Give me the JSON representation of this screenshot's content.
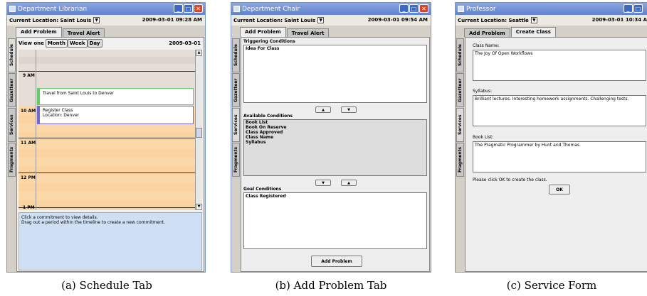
{
  "colors": {
    "title_start": "#8aa6e0",
    "title_end": "#5f83d0",
    "close": "#d8452a",
    "hour_bg": "#fcd8a8",
    "commit1_border": "#66cc66",
    "commit2_border": "#7766cc"
  },
  "win_a": {
    "title": "Department Librarian",
    "location": "Current Location: Saint Louis",
    "datetime": "2009-03-01 09:28 AM",
    "tabs": [
      "Add Problem",
      "Travel Alert"
    ],
    "vtabs": [
      "Schedule",
      "Gazetteer",
      "Services",
      "Fragments"
    ],
    "view_label": "View one",
    "view_buttons": [
      "Month",
      "Week",
      "Day"
    ],
    "date": "2009-03-01",
    "hours": [
      "9 AM",
      "10 AM",
      "11 AM",
      "12 PM",
      "1 PM"
    ],
    "commit1": "Travel from Saint Louis to Denver",
    "commit2_line1": "Register Class",
    "commit2_line2": "Location: Denver",
    "hint1": "Click a commitment to view details.",
    "hint2": "Drag out a period within the timeline to create a new commitment."
  },
  "win_b": {
    "title": "Department Chair",
    "location": "Current Location: Saint Louis",
    "datetime": "2009-03-01 09:54 AM",
    "tabs": [
      "Add Problem",
      "Travel Alert"
    ],
    "vtabs": [
      "Schedule",
      "Gazetteer",
      "Services",
      "Fragments"
    ],
    "triggering_label": "Triggering Conditions",
    "triggering_items": [
      "Idea For Class"
    ],
    "available_label": "Available Conditions",
    "available_items": [
      "Book List",
      "Book On Reserve",
      "Class Approved",
      "Class Name",
      "Syllabus"
    ],
    "goal_label": "Goal Conditions",
    "goal_items": [
      "Class Registered"
    ],
    "add_button": "Add Problem"
  },
  "win_c": {
    "title": "Professor",
    "location": "Current Location: Seattle",
    "datetime": "2009-03-01 10:34 A",
    "tabs": [
      "Add Problem",
      "Create Class"
    ],
    "vtabs": [
      "Schedule",
      "Gazetteer",
      "Services",
      "Fragments"
    ],
    "class_name_label": "Class Name:",
    "class_name_value": "The Joy Of Open Workflows",
    "syllabus_label": "Syllabus:",
    "syllabus_value": "Brilliant lectures. Interesting homework assignments. Challenging tests.",
    "booklist_label": "Book List:",
    "booklist_value": "The Pragmatic Programmer by Hunt and Thomas",
    "prompt": "Please click OK to create the class.",
    "ok": "OK"
  },
  "captions": [
    "(a) Schedule Tab",
    "(b) Add Problem Tab",
    "(c) Service Form"
  ]
}
